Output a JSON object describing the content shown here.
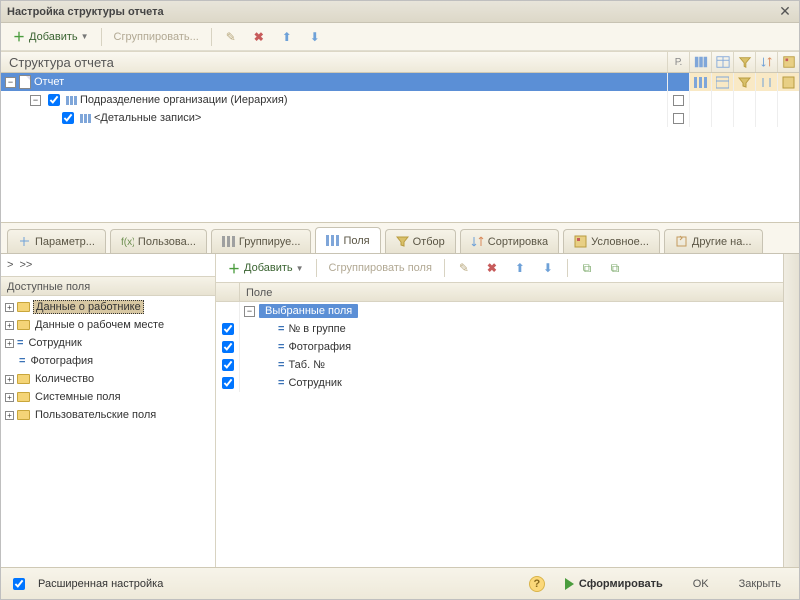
{
  "window": {
    "title": "Настройка структуры отчета",
    "close": "✕"
  },
  "toolbar_top": {
    "add": "Добавить",
    "group": "Сгруппировать..."
  },
  "structure": {
    "header": "Структура отчета",
    "col_r": "Р.",
    "rows": [
      {
        "label": "Отчет"
      },
      {
        "label": "Подразделение организации (Иерархия)"
      },
      {
        "label": "<Детальные записи>"
      }
    ]
  },
  "tabs": {
    "params": "Параметр...",
    "user": "Пользова...",
    "grouping": "Группируе...",
    "fields": "Поля",
    "filter": "Отбор",
    "sort": "Сортировка",
    "conditional": "Условное...",
    "other": "Другие на..."
  },
  "breadcrumb": {
    "root": ">",
    "next": ">>"
  },
  "available": {
    "title": "Доступные поля",
    "items": [
      {
        "label": "Данные о работнике",
        "kind": "folder",
        "exp": true,
        "hl": true
      },
      {
        "label": "Данные о рабочем месте",
        "kind": "folder",
        "exp": true
      },
      {
        "label": "Сотрудник",
        "kind": "field",
        "exp": true
      },
      {
        "label": "Фотография",
        "kind": "field",
        "exp": false
      },
      {
        "label": "Количество",
        "kind": "folder",
        "exp": true
      },
      {
        "label": "Системные поля",
        "kind": "folder",
        "exp": true
      },
      {
        "label": "Пользовательские поля",
        "kind": "folder",
        "exp": true
      }
    ]
  },
  "fields_toolbar": {
    "add": "Добавить",
    "group": "Сгруппировать поля"
  },
  "fields": {
    "header": "Поле",
    "group_label": "Выбранные поля",
    "items": [
      {
        "label": "№ в группе"
      },
      {
        "label": "Фотография"
      },
      {
        "label": "Таб. №"
      },
      {
        "label": "Сотрудник"
      }
    ]
  },
  "footer": {
    "advanced": "Расширенная настройка",
    "run": "Сформировать",
    "ok": "OK",
    "close": "Закрыть"
  }
}
